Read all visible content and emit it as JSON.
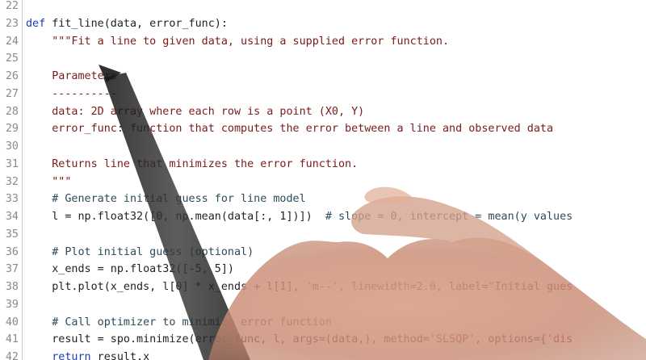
{
  "editor": {
    "lines": [
      {
        "num": "22",
        "segs": [
          {
            "t": "",
            "c": "txt"
          }
        ]
      },
      {
        "num": "23",
        "segs": [
          {
            "t": "def",
            "c": "kw"
          },
          {
            "t": " fit_line(data, error_func):",
            "c": "txt"
          }
        ]
      },
      {
        "num": "24",
        "segs": [
          {
            "t": "    \"\"\"Fit a line to given data, using a supplied error function.",
            "c": "doc"
          }
        ]
      },
      {
        "num": "25",
        "segs": [
          {
            "t": "",
            "c": "doc"
          }
        ]
      },
      {
        "num": "26",
        "segs": [
          {
            "t": "    Parameters",
            "c": "doc"
          }
        ]
      },
      {
        "num": "27",
        "segs": [
          {
            "t": "    ----------",
            "c": "doc"
          }
        ]
      },
      {
        "num": "28",
        "segs": [
          {
            "t": "    data: 2D array where each row is a point (X0, Y)",
            "c": "doc"
          }
        ]
      },
      {
        "num": "29",
        "segs": [
          {
            "t": "    error_func: function that computes the error between a line and observed data",
            "c": "doc"
          }
        ]
      },
      {
        "num": "30",
        "segs": [
          {
            "t": "",
            "c": "doc"
          }
        ]
      },
      {
        "num": "31",
        "segs": [
          {
            "t": "    Returns line that minimizes the error function.",
            "c": "doc"
          }
        ]
      },
      {
        "num": "32",
        "segs": [
          {
            "t": "    \"\"\"",
            "c": "doc"
          }
        ]
      },
      {
        "num": "33",
        "segs": [
          {
            "t": "    # Generate initial guess for line model",
            "c": "cm"
          }
        ]
      },
      {
        "num": "34",
        "segs": [
          {
            "t": "    l = np.float32([0, np.mean(data[:, 1])])  ",
            "c": "txt"
          },
          {
            "t": "# slope = 0, intercept = mean(y values",
            "c": "cm"
          }
        ]
      },
      {
        "num": "35",
        "segs": [
          {
            "t": "",
            "c": "txt"
          }
        ]
      },
      {
        "num": "36",
        "segs": [
          {
            "t": "    # Plot initial guess (optional)",
            "c": "cm"
          }
        ]
      },
      {
        "num": "37",
        "segs": [
          {
            "t": "    x_ends = np.float32([-5, 5])",
            "c": "txt"
          }
        ]
      },
      {
        "num": "38",
        "segs": [
          {
            "t": "    plt.plot(x_ends, l[0] * x_ends + l[1], ",
            "c": "txt"
          },
          {
            "t": "'m--'",
            "c": "str"
          },
          {
            "t": ", linewidth=2.0, label=",
            "c": "txt"
          },
          {
            "t": "\"Initial gues",
            "c": "str"
          }
        ]
      },
      {
        "num": "39",
        "segs": [
          {
            "t": "",
            "c": "txt"
          }
        ]
      },
      {
        "num": "40",
        "segs": [
          {
            "t": "    # Call optimizer to minimize error function",
            "c": "cm"
          }
        ]
      },
      {
        "num": "41",
        "segs": [
          {
            "t": "    result = spo.minimize(error_func, l, args=(data,), method=",
            "c": "txt"
          },
          {
            "t": "'SLSQP'",
            "c": "str"
          },
          {
            "t": ", options={",
            "c": "txt"
          },
          {
            "t": "'dis",
            "c": "str"
          }
        ]
      },
      {
        "num": "42",
        "segs": [
          {
            "t": "    ",
            "c": "txt"
          },
          {
            "t": "return",
            "c": "kw"
          },
          {
            "t": " result.x",
            "c": "txt"
          }
        ]
      }
    ]
  },
  "overlay": {
    "description_icon": "hand-holding-pen-icon"
  }
}
